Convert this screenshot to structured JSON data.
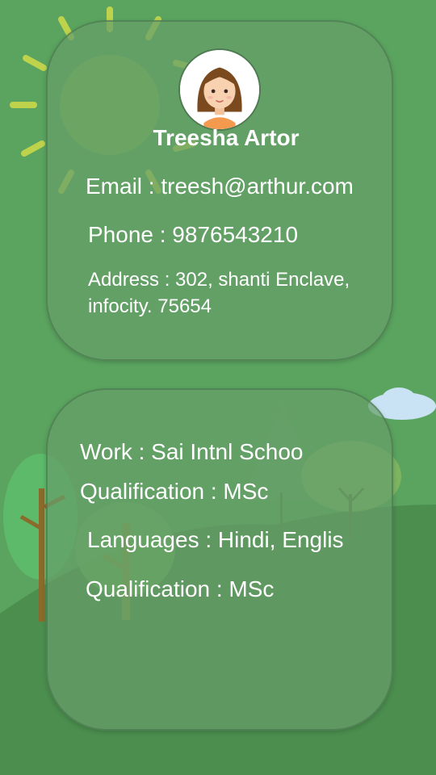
{
  "profile": {
    "name": "Treesha Artor",
    "email": "Email : treesh@arthur.com",
    "phone": "Phone : 9876543210",
    "address": "Address : 302, shanti Enclave, infocity. 75654"
  },
  "details": {
    "work": "Work : Sai  Intnl Schoo",
    "qualification": "Qualification : MSc",
    "languages": "Languages : Hindi, Englis",
    "qualification_repeat": "Qualification : MSc"
  },
  "colors": {
    "background": "#5aa45f",
    "sun": "#c9d84a",
    "cloud": "#c9e3f5",
    "hill": "#4b8e4e",
    "text": "#ffffff"
  },
  "icons": {
    "avatar": "girl-avatar-icon",
    "sun": "sun-decoration",
    "cloud": "cloud-decoration",
    "trees": "tree-decoration"
  }
}
